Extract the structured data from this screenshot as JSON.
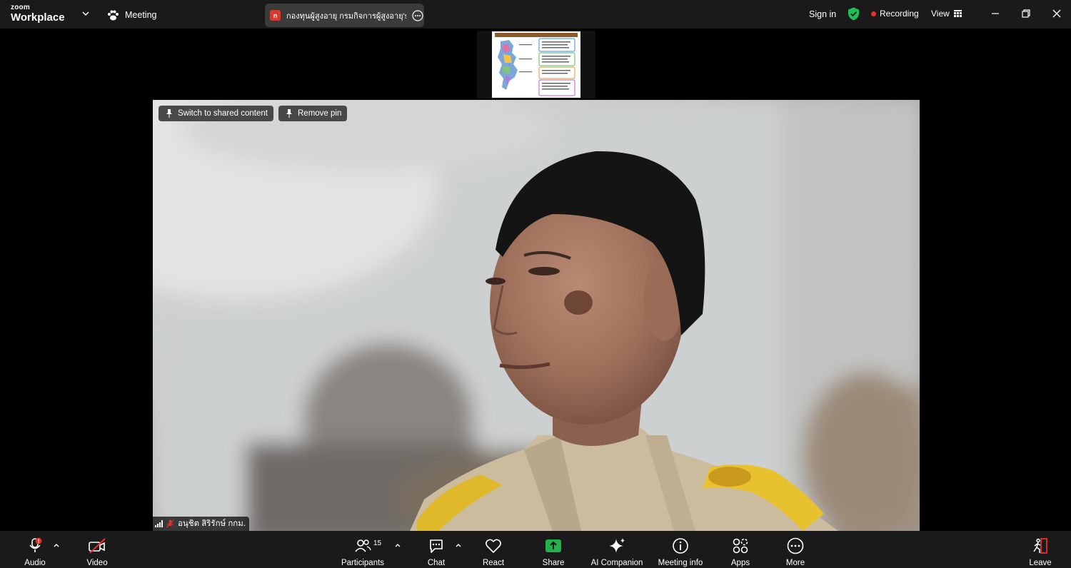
{
  "app": {
    "brand_top": "zoom",
    "brand_bottom": "Workplace",
    "meeting_label": "Meeting"
  },
  "share_tab": {
    "badge": "ก",
    "label": "กองทุนผู้สูงอายุ กรมกิจการผู้สูงอายุ's sc"
  },
  "header": {
    "sign_in": "Sign in",
    "recording": "Recording",
    "view": "View"
  },
  "video": {
    "switch_label": "Switch to shared content",
    "remove_pin_label": "Remove pin",
    "participant_name": "อนุชิต สิริรักษ์ กกม."
  },
  "toolbar": {
    "audio": "Audio",
    "video": "Video",
    "participants": "Participants",
    "participant_count": "15",
    "chat": "Chat",
    "react": "React",
    "share": "Share",
    "ai_companion": "AI Companion",
    "meeting_info": "Meeting info",
    "apps": "Apps",
    "more": "More",
    "leave": "Leave"
  },
  "colors": {
    "titlebar_bg": "#1a1a1a",
    "share_green": "#22b14c",
    "shield_green": "#1fbf58",
    "recording_red": "#e8302c",
    "tab_badge_red": "#d63b2f"
  }
}
